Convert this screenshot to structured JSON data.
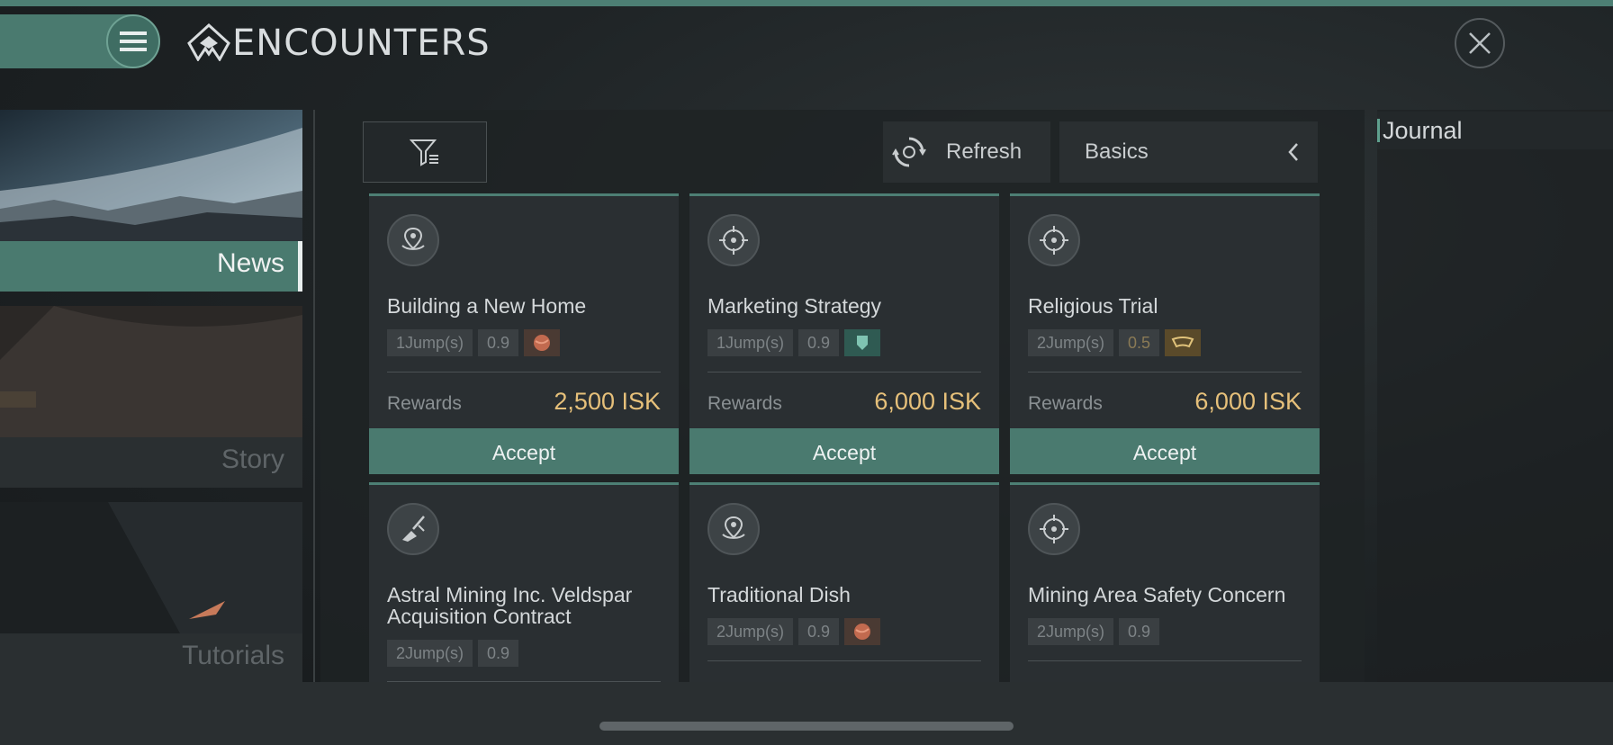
{
  "header": {
    "title": "ENCOUNTERS"
  },
  "nav": {
    "items": [
      {
        "label": "News",
        "active": true
      },
      {
        "label": "Story",
        "active": false
      },
      {
        "label": "Tutorials",
        "active": false
      }
    ]
  },
  "toolbar": {
    "refresh_label": "Refresh",
    "basics_label": "Basics"
  },
  "cards": [
    {
      "title": "Building a New Home",
      "jumps": "1Jump(s)",
      "security": "0.9",
      "faction": "orange-planet-icon",
      "rewards_label": "Rewards",
      "rewards": "2,500 ISK",
      "accept_label": "Accept"
    },
    {
      "title": "Marketing Strategy",
      "jumps": "1Jump(s)",
      "security": "0.9",
      "faction": "teal-shield-icon",
      "rewards_label": "Rewards",
      "rewards": "6,000 ISK",
      "accept_label": "Accept"
    },
    {
      "title": "Religious Trial",
      "jumps": "2Jump(s)",
      "security": "0.5",
      "faction": "gold-crest-icon",
      "rewards_label": "Rewards",
      "rewards": "6,000 ISK",
      "accept_label": "Accept"
    },
    {
      "title": "Astral Mining Inc. Veldspar Acquisition Contract",
      "jumps": "2Jump(s)",
      "security": "0.9"
    },
    {
      "title": "Traditional Dish",
      "jumps": "2Jump(s)",
      "security": "0.9",
      "faction": "orange-planet-icon"
    },
    {
      "title": "Mining Area Safety Concern",
      "jumps": "2Jump(s)",
      "security": "0.9"
    }
  ],
  "journal": {
    "title": "Journal"
  },
  "colors": {
    "accent": "#4a7a6f",
    "reward": "#e6c07a"
  }
}
